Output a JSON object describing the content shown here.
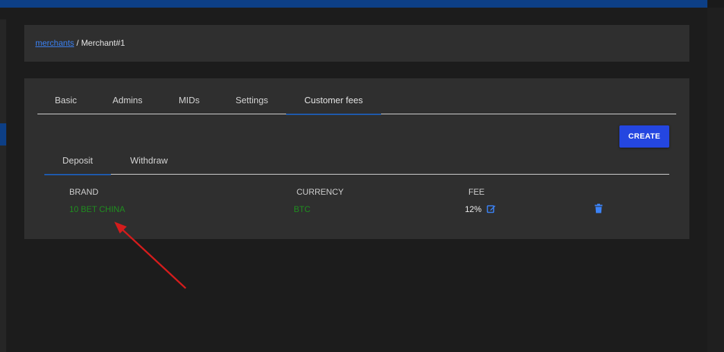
{
  "breadcrumb": {
    "link": "merchants",
    "separator": "/",
    "current": "Merchant#1"
  },
  "tabs": [
    {
      "label": "Basic",
      "active": false
    },
    {
      "label": "Admins",
      "active": false
    },
    {
      "label": "MIDs",
      "active": false
    },
    {
      "label": "Settings",
      "active": false
    },
    {
      "label": "Customer fees",
      "active": true
    }
  ],
  "create_button": "CREATE",
  "subtabs": [
    {
      "label": "Deposit",
      "active": true
    },
    {
      "label": "Withdraw",
      "active": false
    }
  ],
  "table": {
    "headers": [
      "BRAND",
      "CURRENCY",
      "FEE"
    ],
    "rows": [
      {
        "brand": "10 BET CHINA",
        "currency": "BTC",
        "fee": "12%"
      }
    ]
  },
  "icons": {
    "edit": "edit-icon",
    "delete": "trash-icon"
  },
  "colors": {
    "accent": "#2446e0",
    "link": "#3b82f6",
    "value_green": "#1f8f1f",
    "annotation_arrow": "#d41c1c"
  }
}
